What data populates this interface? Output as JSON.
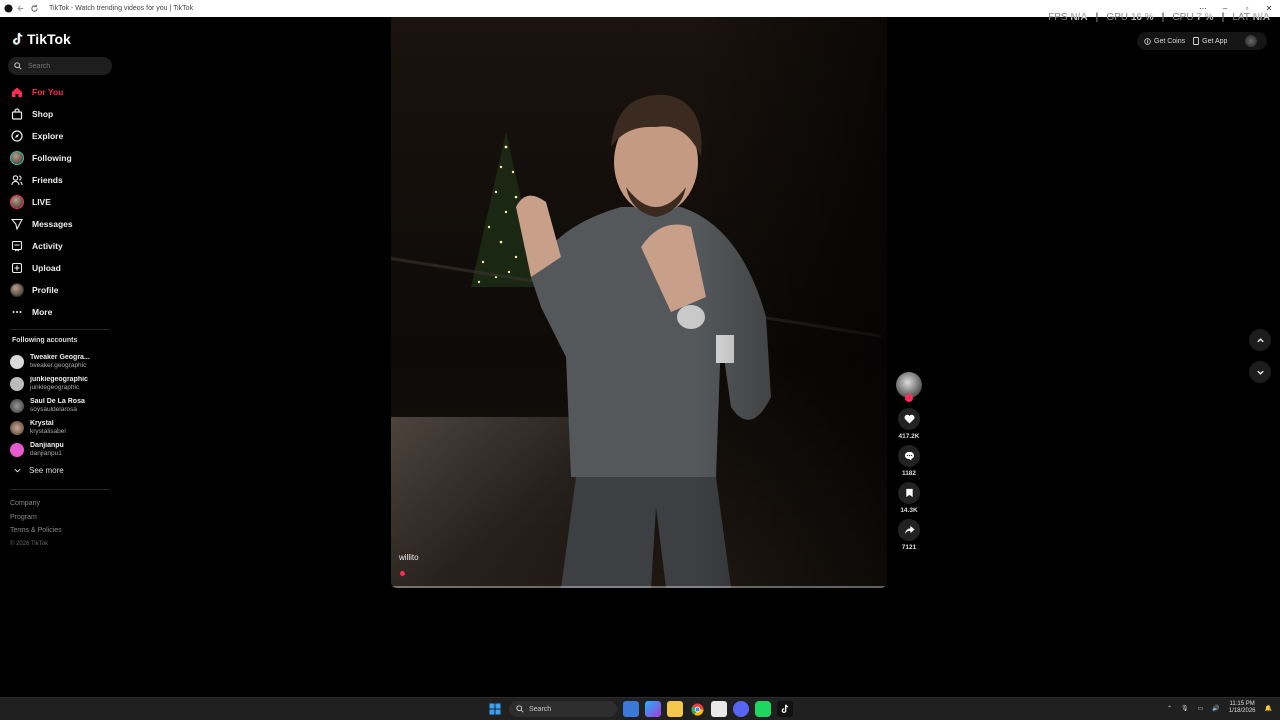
{
  "browser": {
    "tab_title": "TikTok - Watch trending videos for you | TikTok"
  },
  "stats": {
    "fps_label": "FPS",
    "fps_value": "N/A",
    "gpu_label": "GPU",
    "gpu_value": "16 %",
    "cpu_label": "CPU",
    "cpu_value": "7 %",
    "lat_label": "LAT",
    "lat_value": "N/A"
  },
  "sidebar": {
    "logo": "TikTok",
    "search_placeholder": "Search",
    "nav": [
      {
        "label": "For You",
        "icon": "home-icon",
        "active": true
      },
      {
        "label": "Shop",
        "icon": "shop-icon"
      },
      {
        "label": "Explore",
        "icon": "compass-icon"
      },
      {
        "label": "Following",
        "icon": "avatar"
      },
      {
        "label": "Friends",
        "icon": "friends-icon"
      },
      {
        "label": "LIVE",
        "icon": "avatar"
      },
      {
        "label": "Messages",
        "icon": "send-icon"
      },
      {
        "label": "Activity",
        "icon": "activity-icon"
      },
      {
        "label": "Upload",
        "icon": "upload-icon"
      },
      {
        "label": "Profile",
        "icon": "avatar"
      },
      {
        "label": "More",
        "icon": "more-icon"
      }
    ],
    "following_title": "Following accounts",
    "accounts": [
      {
        "name": "Tweaker Geogra...",
        "username": "tweaker.geographic"
      },
      {
        "name": "junkiegeographic",
        "username": "junkiegeographic"
      },
      {
        "name": "Saul De La Rosa",
        "username": "soysauldelarosa"
      },
      {
        "name": "Krystal",
        "username": "krystalisabel"
      },
      {
        "name": "Danjianpu",
        "username": "danjianpu1"
      }
    ],
    "see_more": "See more",
    "footer": {
      "company": "Company",
      "program": "Program",
      "terms": "Terms & Policies",
      "copyright": "© 2026 TikTok"
    }
  },
  "topbar": {
    "get_coins": "Get Coins",
    "get_app": "Get App"
  },
  "video": {
    "author": "willito",
    "likes": "417.2K",
    "comments": "1182",
    "saves": "14.3K",
    "shares": "7121"
  },
  "taskbar": {
    "search_label": "Search",
    "time": "11:15 PM",
    "date": "1/18/2026"
  },
  "colors": {
    "accent": "#fe2c55",
    "background": "#000000"
  }
}
